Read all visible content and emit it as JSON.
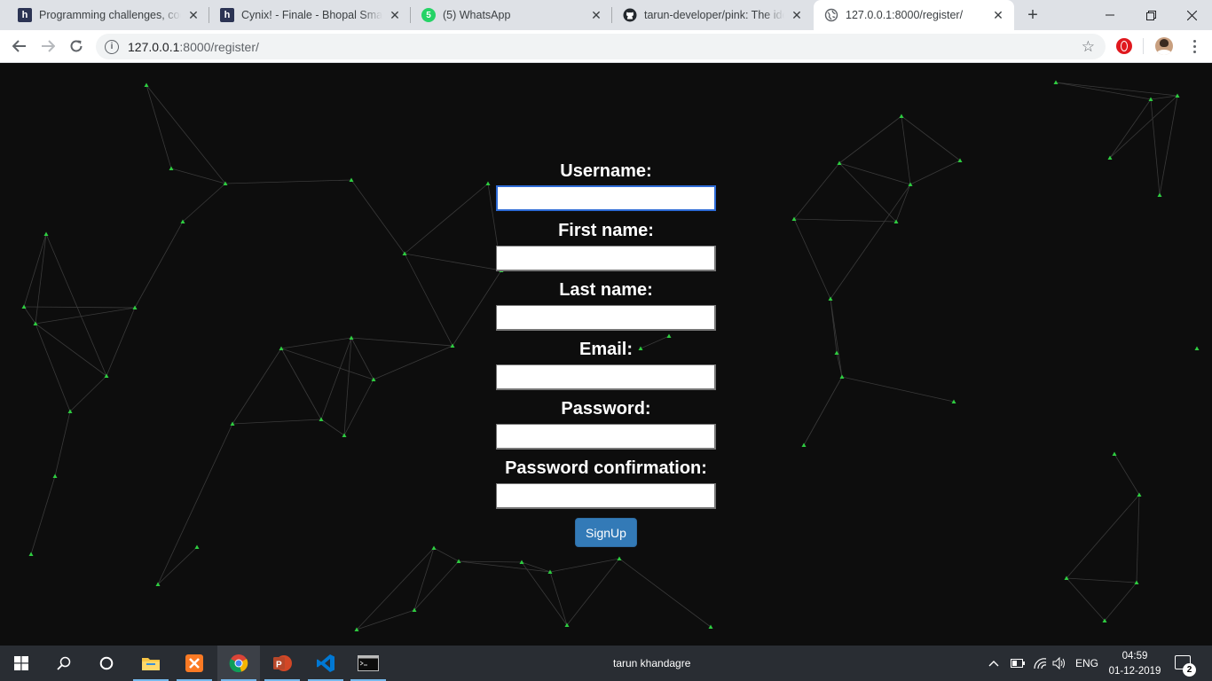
{
  "browser": {
    "tabs": [
      {
        "title": "Programming challenges, codi",
        "favicon": "hackerearth-icon"
      },
      {
        "title": "Cynix! - Finale - Bhopal Smart",
        "favicon": "hackerearth-icon"
      },
      {
        "title": "(5) WhatsApp",
        "favicon": "whatsapp-icon",
        "badge": "5"
      },
      {
        "title": "tarun-developer/pink: The idea",
        "favicon": "github-icon"
      },
      {
        "title": "127.0.0.1:8000/register/",
        "favicon": "globe-icon",
        "active": true
      }
    ],
    "address": {
      "host": "127.0.0.1",
      "rest": ":8000/register/"
    }
  },
  "form": {
    "username_label": "Username:",
    "first_name_label": "First name:",
    "last_name_label": "Last name:",
    "email_label": "Email:",
    "password_label": "Password:",
    "password_confirm_label": "Password confirmation:",
    "username_value": "",
    "first_name_value": "",
    "last_name_value": "",
    "email_value": "",
    "password_value": "",
    "password_confirm_value": "",
    "submit_label": "SignUp"
  },
  "taskbar": {
    "username": "tarun khandagre",
    "language": "ENG",
    "time": "04:59",
    "date": "01-12-2019",
    "notification_count": "2"
  },
  "colors": {
    "page_background": "#0d0d0d",
    "particle_line": "#3a3a3a",
    "particle_dot": "#2ecc40",
    "button_primary": "#337ab7",
    "focus_ring": "#2e6bd6"
  }
}
